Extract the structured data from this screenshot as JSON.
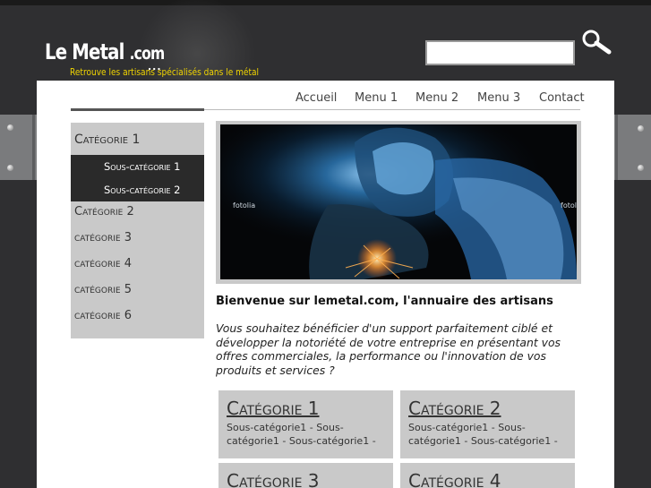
{
  "header": {
    "logo_main": "Le Metal",
    "logo_suffix": ".com",
    "logo_dots": "...",
    "tagline": "Retrouve les artisans spécialisés dans le métal"
  },
  "search": {
    "value": "",
    "icon": "search-icon"
  },
  "nav": {
    "items": [
      "Accueil",
      "Menu 1",
      "Menu 2",
      "Menu 3",
      "Contact"
    ]
  },
  "sidebar": {
    "categories": [
      {
        "label": "Catégorie 1"
      },
      {
        "label": "Catégorie 2"
      },
      {
        "label": "catégorie 3"
      },
      {
        "label": "catégorie 4"
      },
      {
        "label": "catégorie 5"
      },
      {
        "label": "catégorie 6"
      }
    ],
    "subcategories": [
      "Sous-catégorie 1",
      "Sous-catégorie 2"
    ]
  },
  "banner": {
    "watermark_left": "fotolia",
    "watermark_right": "fotol"
  },
  "main": {
    "welcome": "Bienvenue sur lemetal.com, l'annuaire des artisans",
    "intro": "Vous souhaitez bénéficier d'un support parfaitement ciblé et développer la notoriété de votre entreprise en présentant vos offres commerciales, la performance ou l'innovation de vos produits et services ?",
    "cards": [
      {
        "title": "Catégorie 1",
        "text": "Sous-catégorie1 - Sous-catégorie1 - Sous-catégorie1 -"
      },
      {
        "title": "Catégorie 2",
        "text": "Sous-catégorie1 - Sous-catégorie1 - Sous-catégorie1 -"
      },
      {
        "title": "Catégorie 3",
        "text": ""
      },
      {
        "title": "Catégorie 4",
        "text": ""
      }
    ]
  },
  "colors": {
    "background": "#2f2f31",
    "tagline": "#f0d400",
    "panel_grey": "#c9c9c9",
    "active_dark": "#2a2a2a"
  }
}
